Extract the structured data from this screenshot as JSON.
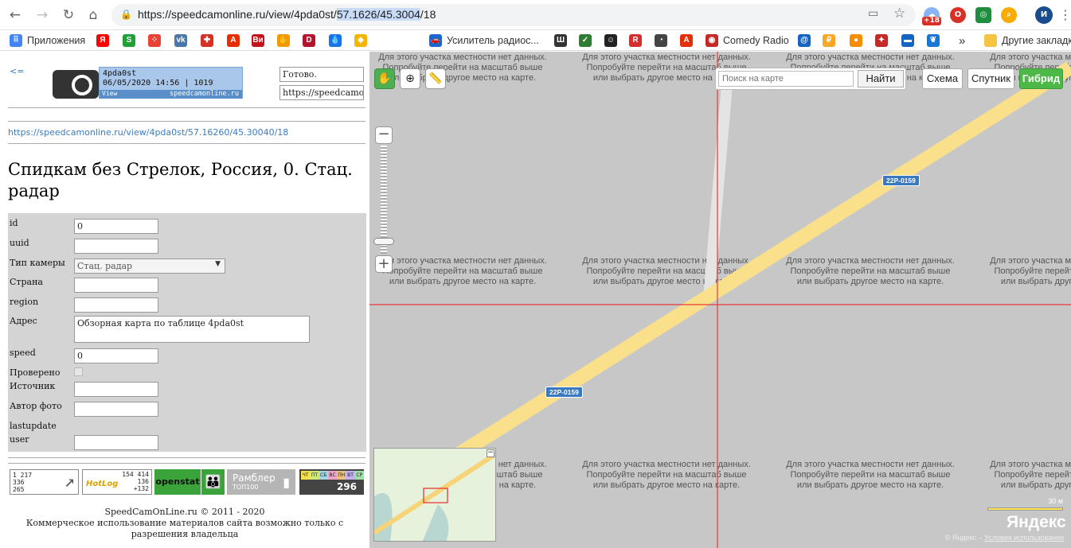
{
  "browser": {
    "url_prefix": "https://speedcamonline.ru/view/4pda0st/",
    "url_selected": "57.1626/45.3004",
    "url_suffix": "/18",
    "badge": "+18",
    "profile_initial": "И"
  },
  "bookmarks": [
    {
      "label": "Приложения",
      "icon": "apps-icon",
      "color": "#4285f4"
    },
    {
      "label": "",
      "icon": "yandex-icon",
      "color": "#ff0000",
      "glyph": "Я"
    },
    {
      "label": "",
      "icon": "sber-icon",
      "color": "#21a038",
      "glyph": "S"
    },
    {
      "label": "",
      "icon": "dots-icon",
      "color": "#e94335",
      "glyph": "⁘"
    },
    {
      "label": "",
      "icon": "vk-icon",
      "color": "#4a76a8",
      "glyph": "vk"
    },
    {
      "label": "",
      "icon": "puzzle-icon",
      "color": "#d93025",
      "glyph": "✚"
    },
    {
      "label": "",
      "icon": "aliexpress-icon",
      "color": "#e62e04",
      "glyph": "A"
    },
    {
      "label": "",
      "icon": "vi-icon",
      "color": "#c4131a",
      "glyph": "Ви"
    },
    {
      "label": "",
      "icon": "hand-icon",
      "color": "#f29900",
      "glyph": "✋"
    },
    {
      "label": "",
      "icon": "d-icon",
      "color": "#b3132b",
      "glyph": "D"
    },
    {
      "label": "",
      "icon": "drop-icon",
      "color": "#1a73e8",
      "glyph": "💧"
    },
    {
      "label": "",
      "icon": "shield-icon",
      "color": "#f4b400",
      "glyph": "◈"
    },
    {
      "label": "Усилитель радиос...",
      "icon": "car-icon",
      "color": "#1967d2",
      "glyph": "🚗"
    },
    {
      "label": "",
      "icon": "sh-icon",
      "color": "#333333",
      "glyph": "Ш"
    },
    {
      "label": "",
      "icon": "mark-icon",
      "color": "#2e7d32",
      "glyph": "✓"
    },
    {
      "label": "",
      "icon": "face-icon",
      "color": "#222222",
      "glyph": "☺"
    },
    {
      "label": "",
      "icon": "r-icon",
      "color": "#d32f2f",
      "glyph": "R"
    },
    {
      "label": "",
      "icon": "speedometer-icon",
      "color": "#444444",
      "glyph": "◔"
    },
    {
      "label": "",
      "icon": "bag-icon",
      "color": "#e62e04",
      "glyph": "A"
    },
    {
      "label": "Comedy Radio",
      "icon": "radio-icon",
      "color": "#c62828",
      "glyph": "◉"
    },
    {
      "label": "",
      "icon": "mail-icon",
      "color": "#1565c0",
      "glyph": "@"
    },
    {
      "label": "",
      "icon": "money-icon",
      "color": "#f9a825",
      "glyph": "₽"
    },
    {
      "label": "",
      "icon": "orange-icon",
      "color": "#fb8c00",
      "glyph": "●"
    },
    {
      "label": "",
      "icon": "bird-icon",
      "color": "#c62828",
      "glyph": "✦"
    },
    {
      "label": "",
      "icon": "flag-icon",
      "color": "#1565c0",
      "glyph": "▬"
    },
    {
      "label": "",
      "icon": "ear-icon",
      "color": "#1976d2",
      "glyph": "❦"
    },
    {
      "label": "Другие закладк",
      "icon": "folder-icon",
      "color": "#f4c542",
      "glyph": ""
    }
  ],
  "page": {
    "back_link": "<=",
    "logo": {
      "brand": "Online",
      "line1": "4pda0st",
      "line2": "06/05/2020 14:56 | 10191",
      "line3_left": "View",
      "line3_right": "speedcamonline.ru"
    },
    "status_field": "Готово.",
    "url_field": "https://speedcamon",
    "permalink": "https://speedcamonline.ru/view/4pda0st/57.16260/45.30040/18",
    "title": "Спидкам без Стрелок, Россия, 0. Стац. радар"
  },
  "form": {
    "fields": [
      {
        "label": "id",
        "value": "0",
        "type": "text"
      },
      {
        "label": "uuid",
        "value": "",
        "type": "text"
      },
      {
        "label": "Тип камеры",
        "value": "Стац. радар",
        "type": "select"
      },
      {
        "label": "Страна",
        "value": "",
        "type": "text"
      },
      {
        "label": "region",
        "value": "",
        "type": "text"
      },
      {
        "label": "Адрес",
        "value": "Обзорная карта по таблице 4pda0st",
        "type": "textarea"
      },
      {
        "label": "speed",
        "value": "0",
        "type": "text"
      },
      {
        "label": "Проверено",
        "value": "",
        "type": "checkbox"
      },
      {
        "label": "Источник",
        "value": "",
        "type": "text"
      },
      {
        "label": "Автор фото",
        "value": "",
        "type": "text"
      },
      {
        "label": "lastupdate",
        "value": "",
        "type": "none"
      },
      {
        "label": "user",
        "value": "",
        "type": "text"
      }
    ]
  },
  "counters": {
    "c1": [
      "1 217",
      "336",
      "265"
    ],
    "c2_brand": "HotLog",
    "c2": [
      "154 414",
      "136",
      "+132"
    ],
    "c3": "openstat",
    "c4_brand": "Рамблер",
    "c4_sub": "ТОП100",
    "c5_days": [
      "ЧТ",
      "ПТ",
      "СБ",
      "ВС",
      "ПН",
      "ВТ",
      "СР"
    ],
    "c5_value": "296"
  },
  "footer": {
    "line1": "SpeedCamOnLine.ru © 2011 - 2020",
    "line2": "Коммерческое использование материалов сайта возможно только с разрешения владельца"
  },
  "map": {
    "search_placeholder": "Поиск на карте",
    "find_label": "Найти",
    "types": [
      "Схема",
      "Спутник",
      "Гибрид"
    ],
    "active_type": "Гибрид",
    "nodata_line1": "Для этого участка местности нет данных.",
    "nodata_line2": "Попробуйте перейти на масштаб выше",
    "nodata_line3": "или выбрать другое место на карте.",
    "road_label": "22Р-0159",
    "scale": "30 м",
    "yandex_logo": "Яндекс",
    "copyright": "© Яндекс – ",
    "terms": "Условия использования",
    "zoom_level": 0.12
  }
}
